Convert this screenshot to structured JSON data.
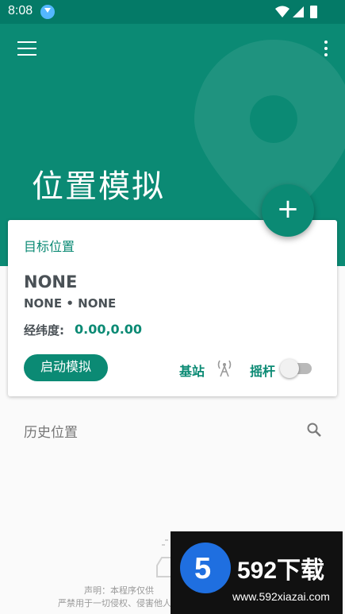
{
  "status_bar": {
    "time": "8:08"
  },
  "app_bar": {
    "title": "位置模拟"
  },
  "fab": {
    "icon": "plus-icon",
    "label": "+"
  },
  "target_card": {
    "label": "目标位置",
    "name": "NONE",
    "subtitle": "NONE • NONE",
    "coords_label": "经纬度:",
    "coords_value": "0.00,0.00",
    "start_button": "启动模拟",
    "base_station_label": "基站",
    "joystick_label": "摇杆",
    "joystick_enabled": false
  },
  "history": {
    "title": "历史位置"
  },
  "disclaimer": {
    "line1": "声明：本程序仅供",
    "line2": "严禁用于一切侵权、侵害他人利"
  },
  "watermark": {
    "brand": "592下载",
    "url": "www.592xiazai.com",
    "logo_number": "5"
  },
  "colors": {
    "primary": "#0b8a74",
    "status_bar": "#047a67",
    "text_dark": "#4a5156"
  }
}
